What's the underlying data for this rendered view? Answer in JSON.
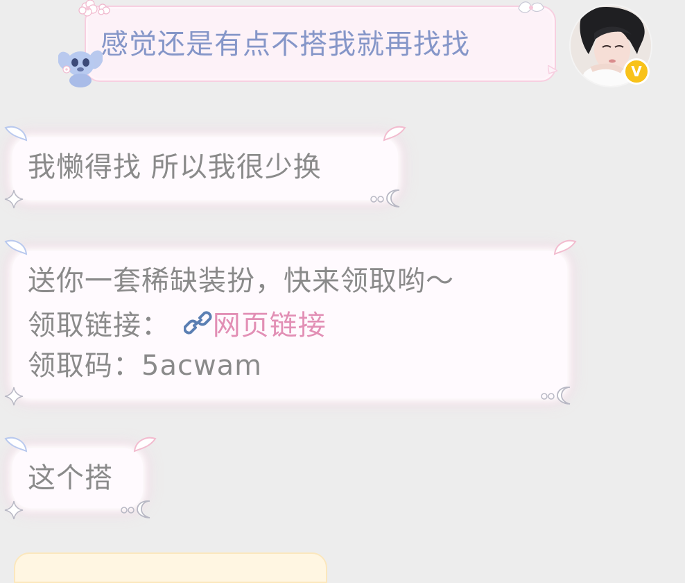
{
  "messages": {
    "outgoing": {
      "text": "感觉还是有点不搭我就再找找"
    },
    "incoming": [
      {
        "lines": [
          "我懒得找  所以我很少换"
        ]
      },
      {
        "line1": "送你一套稀缺装扮，快来领取哟～",
        "line2_label": "领取链接：",
        "line2_link": "网页链接",
        "line3_label": "领取码：",
        "line3_code": "5acwam"
      },
      {
        "lines": [
          "这个搭"
        ]
      }
    ]
  },
  "avatar": {
    "badge": "V"
  },
  "icons": {
    "link": "link-icon",
    "wing": "angel-wing-icon",
    "sparkle": "sparkle-icon",
    "moon": "moon-icon"
  },
  "colors": {
    "background": "#ededed",
    "outgoing_text": "#8596c8",
    "incoming_text": "#8a8a8a",
    "link": "#e28fb5",
    "badge": "#f8c21a"
  }
}
